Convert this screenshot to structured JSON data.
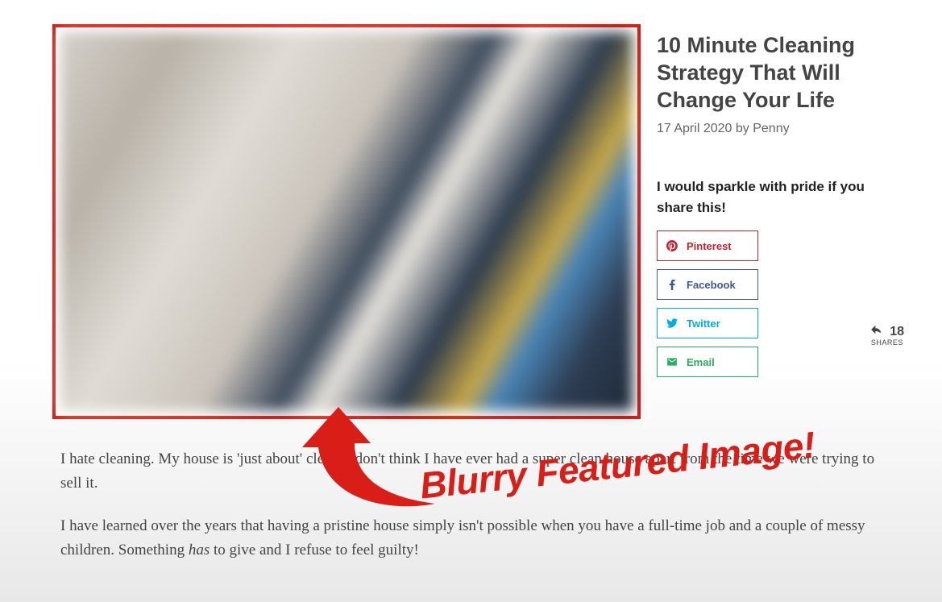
{
  "article": {
    "title": "10 Minute Cleaning Strategy That Will Change Your Life",
    "date": "17 April 2020",
    "by_word": "by",
    "author": "Penny",
    "para1": "I hate cleaning. My house is 'just about' clean. I don't think I have ever had a super clean house apart from the time we were trying to sell it.",
    "para2_a": "I have learned over the years that having a pristine house simply isn't possible when you have a full-time job and a couple of messy children. Something ",
    "para2_em": "has",
    "para2_b": " to give and I refuse to feel guilty!"
  },
  "share": {
    "heading": "I would sparkle with pride if you share this!",
    "pinterest": "Pinterest",
    "facebook": "Facebook",
    "twitter": "Twitter",
    "email": "Email",
    "count": "18",
    "count_label": "SHARES"
  },
  "annotation": {
    "text": "Blurry Featured Image!"
  }
}
